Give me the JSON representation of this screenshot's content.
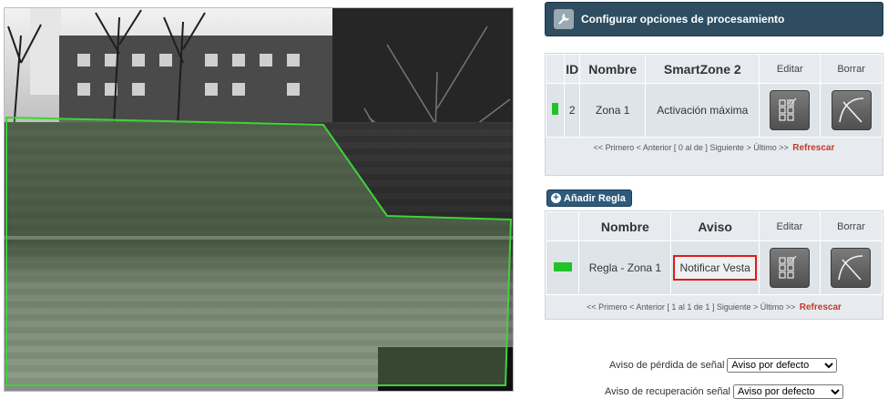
{
  "header": {
    "title": "Configurar opciones de procesamiento",
    "icon": "wrench-icon"
  },
  "zones": {
    "columns": [
      "ID",
      "Nombre",
      "SmartZone 2",
      "Editar",
      "Borrar"
    ],
    "rows": [
      {
        "id": "2",
        "name": "Zona 1",
        "smartzone": "Activación máxima",
        "color": "#22c22a"
      }
    ],
    "pager_text": "<< Primero < Anterior [ 0 al de ] Siguiente > Último >>",
    "refresh": "Refrescar"
  },
  "add_rule": {
    "label": "Añadir Regla"
  },
  "rules": {
    "columns": [
      "Nombre",
      "Aviso",
      "Editar",
      "Borrar"
    ],
    "rows": [
      {
        "name": "Regla - Zona 1",
        "notify": "Notificar Vesta",
        "color": "#22c22a"
      }
    ],
    "pager_text": "<< Primero < Anterior [ 1 al 1 de 1 ] Siguiente > Último >>",
    "refresh": "Refrescar"
  },
  "options": {
    "signal_loss_label": "Aviso de pérdida de señal",
    "signal_loss_value": "Aviso por defecto",
    "signal_recovery_label": "Aviso de recuperación señal",
    "signal_recovery_value": "Aviso por defecto"
  },
  "colors": {
    "header_bg": "#2e4d60",
    "zone_outline": "#3fd23a",
    "refresh": "#c0392b",
    "highlight": "#e01b1b"
  }
}
